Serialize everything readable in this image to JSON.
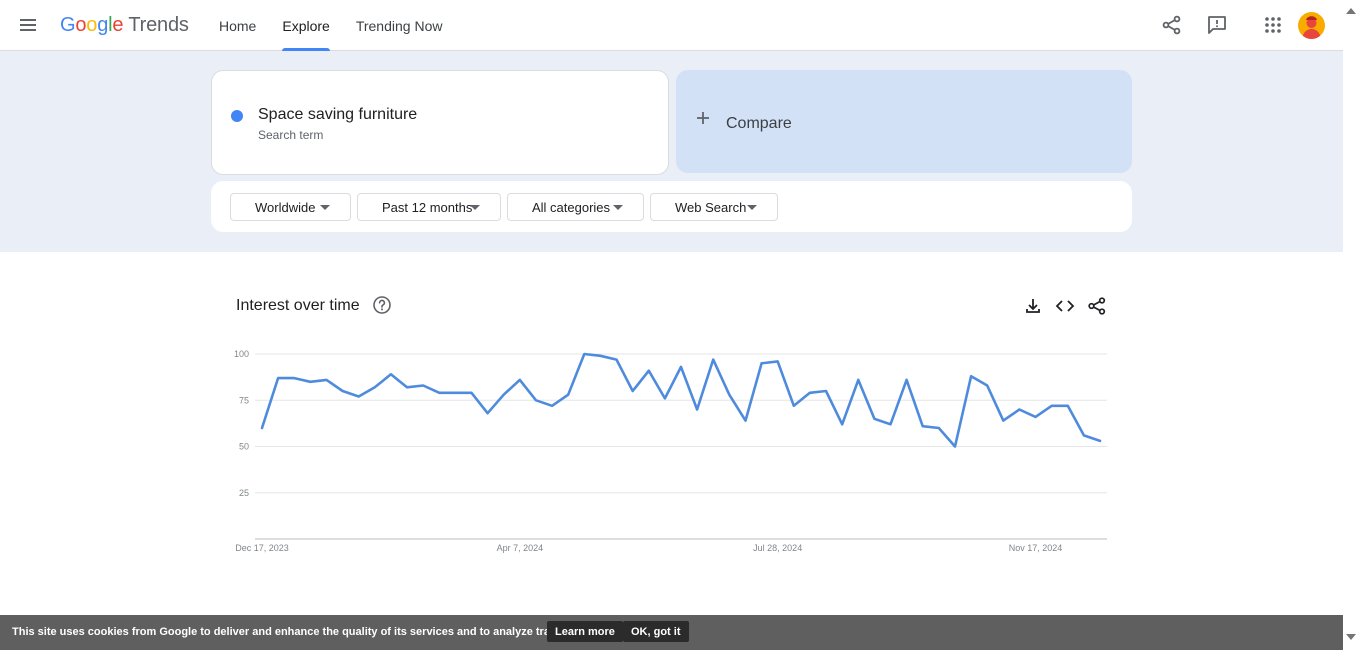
{
  "header": {
    "logo_letters": [
      "G",
      "o",
      "o",
      "g",
      "l",
      "e"
    ],
    "logo_product": "Trends",
    "nav": [
      {
        "label": "Home",
        "active": false
      },
      {
        "label": "Explore",
        "active": true
      },
      {
        "label": "Trending Now",
        "active": false
      }
    ],
    "icons": [
      "menu-icon",
      "share-icon",
      "feedback-icon",
      "apps-icon",
      "avatar"
    ]
  },
  "search": {
    "term": "Space saving furniture",
    "term_type": "Search term",
    "term_color": "#4285f4",
    "compare_label": "Compare"
  },
  "filters": [
    {
      "label": "Worldwide"
    },
    {
      "label": "Past 12 months"
    },
    {
      "label": "All categories"
    },
    {
      "label": "Web Search"
    }
  ],
  "interest_card": {
    "title": "Interest over time",
    "icons": [
      "help-icon",
      "download-icon",
      "embed-icon",
      "share-icon"
    ]
  },
  "chart_data": {
    "type": "line",
    "title": "Interest over time",
    "xlabel": "",
    "ylabel": "",
    "ylim": [
      0,
      100
    ],
    "yticks": [
      25,
      50,
      75,
      100
    ],
    "x_tick_labels": [
      "Dec 17, 2023",
      "Apr 7, 2024",
      "Jul 28, 2024",
      "Nov 17, 2024"
    ],
    "x_tick_index": [
      0,
      16,
      32,
      48
    ],
    "grid": true,
    "line_color": "#4f8bdd",
    "series": [
      {
        "values": [
          60,
          87,
          87,
          85,
          86,
          80,
          77,
          82,
          89,
          82,
          83,
          79,
          79,
          79,
          68,
          78,
          86,
          75,
          72,
          78,
          100,
          99,
          97,
          80,
          91,
          76,
          93,
          70,
          97,
          78,
          64,
          95,
          96,
          72,
          79,
          80,
          62,
          86,
          65,
          62,
          86,
          61,
          60,
          50,
          88,
          83,
          64,
          70,
          66,
          72,
          72,
          56,
          53
        ]
      }
    ]
  },
  "cookie": {
    "text": "This site uses cookies from Google to deliver and enhance the quality of its services and to analyze traffic.",
    "learn_more": "Learn more",
    "ok": "OK, got it"
  }
}
